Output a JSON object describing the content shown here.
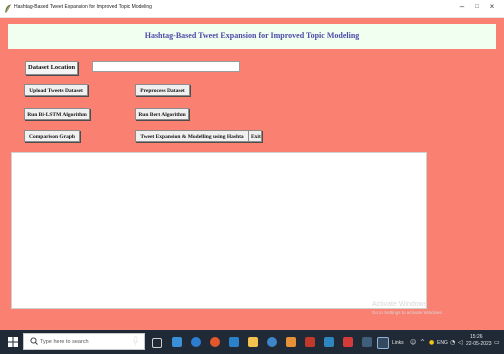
{
  "window": {
    "title": "Hashtag-Based Tweet Expansion for Improved Topic Modeling",
    "minimize_glyph": "–",
    "maximize_glyph": "□",
    "close_glyph": "×"
  },
  "app": {
    "heading": "Hashtag-Based Tweet Expansion for Improved Topic Modeling",
    "dataset_label": "Dataset Location",
    "dataset_value": "",
    "buttons": {
      "upload": "Upload Tweets Dataset",
      "preprocess": "Preprocess Dataset",
      "bilstm": "Run Bi-LSTM Algorithm",
      "bert": "Run Bert Algorithm",
      "comparison": "Comparison Graph",
      "expansion": "Tweet Expansion & Modelling using Hashta",
      "exit": "Exit"
    },
    "output_text": ""
  },
  "watermark": {
    "line1": "Activate Windows",
    "line2": "Go to Settings to activate Windows."
  },
  "taskbar": {
    "search_placeholder": "Type here to search",
    "links_label": "Links",
    "language": "ENG",
    "time": "15:26",
    "date": "22-05-2023"
  },
  "colors": {
    "client_bg": "#fa8072",
    "header_bg": "#f0fff0",
    "heading_text": "#4a4aa8",
    "taskbar_bg": "#1f2a36"
  }
}
